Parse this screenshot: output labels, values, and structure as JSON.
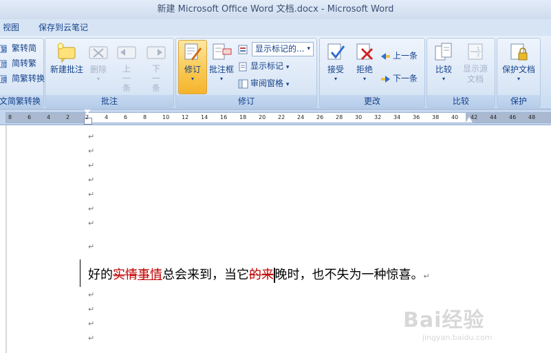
{
  "window": {
    "title": "新建 Microsoft Office Word 文档.docx - Microsoft Word"
  },
  "tabs": [
    {
      "label": "视图"
    },
    {
      "label": "保存到云笔记"
    }
  ],
  "ribbon": {
    "chinese": {
      "label": "文简繁转换",
      "buttons": [
        "繁转简",
        "简转繁",
        "简繁转换"
      ]
    },
    "comments": {
      "label": "批注",
      "new": "新建批注",
      "delete": "删除",
      "prev": "上一条",
      "next": "下一条"
    },
    "tracking": {
      "label": "修订",
      "track": "修订",
      "balloons": "批注框",
      "display_value": "显示标记的...",
      "show_markup": "显示标记",
      "reviewing_pane": "审阅窗格"
    },
    "changes": {
      "label": "更改",
      "accept": "接受",
      "reject": "拒绝",
      "prev": "上一条",
      "next": "下一条"
    },
    "compare": {
      "label": "比较",
      "compare": "比较",
      "show_source": "显示源文档"
    },
    "protect": {
      "label": "保护",
      "protect_doc": "保护文档"
    }
  },
  "ruler": {
    "ticks": [
      "8",
      "6",
      "4",
      "2",
      "2",
      "4",
      "6",
      "8",
      "10",
      "12",
      "14",
      "16",
      "18",
      "20",
      "22",
      "24",
      "26",
      "28",
      "30",
      "32",
      "34",
      "36",
      "38",
      "40",
      "42",
      "44",
      "46",
      "48"
    ]
  },
  "document": {
    "para_mark": "↵",
    "line": {
      "t1": "好的",
      "del1": "实情",
      "ins1": "事情",
      "t2": "总会来到，当它",
      "del2": "的来",
      "t3": "晚时，也不失为一种惊喜。"
    }
  },
  "watermark": {
    "brand": "Bai经验",
    "url": "jingyan.baidu.com"
  }
}
